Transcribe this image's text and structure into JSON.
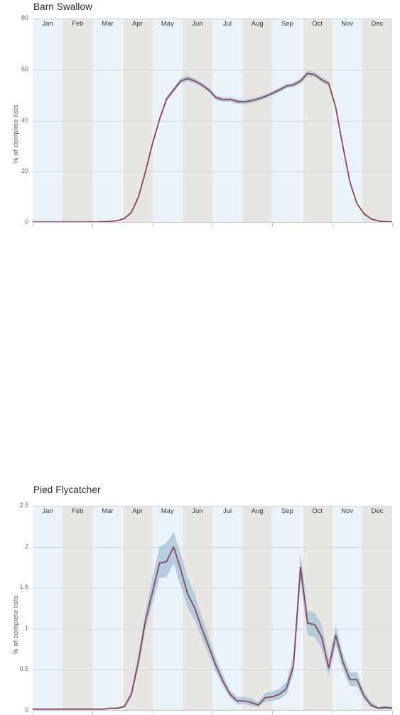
{
  "axis": {
    "ylabel": "% of complete lists",
    "months": [
      "Jan",
      "Feb",
      "Mar",
      "Apr",
      "May",
      "Jun",
      "Jul",
      "Aug",
      "Sep",
      "Oct",
      "Nov",
      "Dec"
    ]
  },
  "colors": {
    "line": "#8f3c4e",
    "band_ci": "#aac6da",
    "month_odd": "#eaf2fa",
    "month_even": "#e7e6e3",
    "gridline": "#ced6dd",
    "text": "#3c3c3c"
  },
  "panels": [
    {
      "title": "Barn Swallow",
      "yticks": [
        "80",
        "60",
        "40",
        "20",
        "0"
      ]
    },
    {
      "title": "Pied Flycatcher",
      "yticks": [
        "2.5",
        "2",
        "1.5",
        "1",
        "0.5",
        "0"
      ]
    }
  ],
  "chart_data": [
    {
      "type": "line",
      "title": "Barn Swallow",
      "xlabel": "",
      "ylabel": "% of complete lists",
      "ylim": [
        0,
        80
      ],
      "yticks": [
        0,
        20,
        40,
        60,
        80
      ],
      "grid": true,
      "legend": null,
      "x_categories": [
        "Jan",
        "Feb",
        "Mar",
        "Apr",
        "May",
        "Jun",
        "Jul",
        "Aug",
        "Sep",
        "Oct",
        "Nov",
        "Dec"
      ],
      "x_unit": "week-of-year (1-52)",
      "xlim": [
        1,
        52
      ],
      "series": [
        {
          "name": "Barn Swallow % of complete lists",
          "x": [
            1,
            2,
            3,
            4,
            5,
            6,
            7,
            8,
            9,
            10,
            11,
            12,
            13,
            14,
            15,
            16,
            17,
            18,
            19,
            20,
            21,
            22,
            23,
            24,
            25,
            26,
            27,
            28,
            29,
            30,
            31,
            32,
            33,
            34,
            35,
            36,
            37,
            38,
            39,
            40,
            41,
            42,
            43,
            44,
            45,
            46,
            47,
            48,
            49,
            50,
            51,
            52
          ],
          "values": [
            0.3,
            0.3,
            0.3,
            0.3,
            0.3,
            0.3,
            0.3,
            0.3,
            0.3,
            0.3,
            0.4,
            0.5,
            0.8,
            1.6,
            4.0,
            10.0,
            20.0,
            31.0,
            40.5,
            48.5,
            52.0,
            55.5,
            56.5,
            55.5,
            54.0,
            52.0,
            49.0,
            48.2,
            48.3,
            47.5,
            47.3,
            47.8,
            48.5,
            49.5,
            50.7,
            52.0,
            53.5,
            54.0,
            55.5,
            58.5,
            58.0,
            56.0,
            54.5,
            45.0,
            30.0,
            16.0,
            7.5,
            3.5,
            1.5,
            0.7,
            0.4,
            0.3
          ],
          "ci_low": [
            0.2,
            0.2,
            0.2,
            0.2,
            0.2,
            0.2,
            0.2,
            0.2,
            0.2,
            0.2,
            0.3,
            0.4,
            0.6,
            1.3,
            3.5,
            9.3,
            19.2,
            30.2,
            39.6,
            47.6,
            51.1,
            54.5,
            55.4,
            54.5,
            53.1,
            51.1,
            48.1,
            47.3,
            47.4,
            46.6,
            46.4,
            46.9,
            47.6,
            48.6,
            49.8,
            51.1,
            52.6,
            53.1,
            54.5,
            57.4,
            57.0,
            55.0,
            53.5,
            44.1,
            29.2,
            15.4,
            7.0,
            3.1,
            1.2,
            0.5,
            0.3,
            0.2
          ],
          "ci_high": [
            0.4,
            0.4,
            0.4,
            0.4,
            0.4,
            0.4,
            0.4,
            0.4,
            0.4,
            0.4,
            0.5,
            0.6,
            1.0,
            1.9,
            4.5,
            10.7,
            20.8,
            31.8,
            41.4,
            49.4,
            52.9,
            56.5,
            57.6,
            56.5,
            54.9,
            52.9,
            49.9,
            49.1,
            49.2,
            48.4,
            48.2,
            48.7,
            49.4,
            50.4,
            51.6,
            52.9,
            54.4,
            54.9,
            56.5,
            59.6,
            59.0,
            57.0,
            55.5,
            45.9,
            30.8,
            16.6,
            8.0,
            3.9,
            1.8,
            0.9,
            0.5,
            0.4
          ]
        }
      ]
    },
    {
      "type": "line",
      "title": "Pied Flycatcher",
      "xlabel": "",
      "ylabel": "% of complete lists",
      "ylim": [
        0,
        2.5
      ],
      "yticks": [
        0,
        0.5,
        1,
        1.5,
        2,
        2.5
      ],
      "grid": true,
      "legend": null,
      "x_categories": [
        "Jan",
        "Feb",
        "Mar",
        "Apr",
        "May",
        "Jun",
        "Jul",
        "Aug",
        "Sep",
        "Oct",
        "Nov",
        "Dec"
      ],
      "x_unit": "week-of-year (1-52)",
      "xlim": [
        1,
        52
      ],
      "series": [
        {
          "name": "Pied Flycatcher % of complete lists",
          "x": [
            1,
            2,
            3,
            4,
            5,
            6,
            7,
            8,
            9,
            10,
            11,
            12,
            13,
            14,
            15,
            16,
            17,
            18,
            19,
            20,
            21,
            22,
            23,
            24,
            25,
            26,
            27,
            28,
            29,
            30,
            31,
            32,
            33,
            34,
            35,
            36,
            37,
            38,
            39,
            40,
            41,
            42,
            43,
            44,
            45,
            46,
            47,
            48,
            49,
            50,
            51,
            52
          ],
          "values": [
            0.02,
            0.02,
            0.02,
            0.02,
            0.02,
            0.02,
            0.02,
            0.02,
            0.02,
            0.02,
            0.02,
            0.03,
            0.03,
            0.05,
            0.2,
            0.6,
            1.1,
            1.45,
            1.8,
            1.82,
            2.0,
            1.72,
            1.42,
            1.25,
            1.0,
            0.78,
            0.55,
            0.36,
            0.2,
            0.12,
            0.12,
            0.1,
            0.07,
            0.16,
            0.17,
            0.2,
            0.27,
            0.55,
            1.75,
            1.07,
            1.05,
            0.9,
            0.52,
            0.92,
            0.6,
            0.38,
            0.38,
            0.18,
            0.07,
            0.03,
            0.04,
            0.03
          ],
          "ci_low": [
            0.01,
            0.01,
            0.01,
            0.01,
            0.01,
            0.01,
            0.01,
            0.01,
            0.01,
            0.01,
            0.01,
            0.02,
            0.02,
            0.04,
            0.16,
            0.52,
            0.99,
            1.3,
            1.62,
            1.63,
            1.8,
            1.52,
            1.25,
            1.1,
            0.88,
            0.68,
            0.47,
            0.3,
            0.16,
            0.08,
            0.08,
            0.06,
            0.04,
            0.11,
            0.12,
            0.14,
            0.2,
            0.44,
            1.58,
            0.92,
            0.9,
            0.76,
            0.42,
            0.8,
            0.5,
            0.3,
            0.3,
            0.13,
            0.04,
            0.02,
            0.02,
            0.02
          ],
          "ci_high": [
            0.03,
            0.03,
            0.03,
            0.03,
            0.03,
            0.03,
            0.03,
            0.03,
            0.03,
            0.03,
            0.03,
            0.04,
            0.04,
            0.07,
            0.25,
            0.7,
            1.22,
            1.62,
            2.0,
            2.05,
            2.18,
            1.92,
            1.62,
            1.42,
            1.14,
            0.9,
            0.64,
            0.43,
            0.25,
            0.17,
            0.17,
            0.15,
            0.11,
            0.22,
            0.23,
            0.27,
            0.35,
            0.68,
            1.93,
            1.22,
            1.2,
            1.05,
            0.63,
            1.04,
            0.7,
            0.47,
            0.47,
            0.24,
            0.11,
            0.05,
            0.06,
            0.05
          ]
        }
      ]
    }
  ]
}
